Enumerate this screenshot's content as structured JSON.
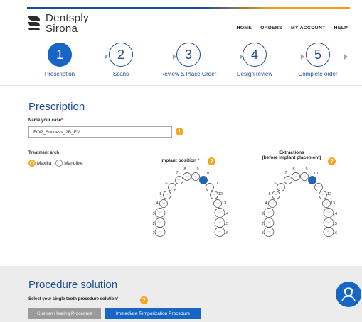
{
  "brand": {
    "line1": "Dentsply",
    "line2": "Sirona"
  },
  "nav": {
    "home": "HOME",
    "orders": "ORDERS",
    "account": "MY ACCOUNT",
    "help": "HELP"
  },
  "steps": [
    {
      "num": "1",
      "label": "Prescription",
      "active": true
    },
    {
      "num": "2",
      "label": "Scans",
      "active": false
    },
    {
      "num": "3",
      "label": "Review & Place Order",
      "active": false
    },
    {
      "num": "4",
      "label": "Design review",
      "active": false
    },
    {
      "num": "5",
      "label": "Complete order",
      "active": false
    }
  ],
  "prescription": {
    "title": "Prescription",
    "case_label": "Name your case",
    "case_required": "*",
    "case_value": "FOP_Success_2B_EV",
    "arch_label": "Treatment arch",
    "arch_options": [
      "Maxilla",
      "Mandible"
    ],
    "arch_selected": "Maxilla",
    "implant_title": "Implant position",
    "implant_required": "*",
    "extraction_title_1": "Extractions",
    "extraction_title_2": "(before implant placement)",
    "tooth_numbers": [
      "1",
      "2",
      "3",
      "4",
      "5",
      "6",
      "7",
      "8",
      "9",
      "10",
      "11",
      "12",
      "13",
      "14",
      "15",
      "16"
    ],
    "implant_selected_tooth": "10",
    "extraction_selected_tooth": "10",
    "help_glyph": "?",
    "warn_glyph": "!"
  },
  "procedure": {
    "title": "Procedure solution",
    "label": "Select your single tooth procedure solution",
    "required": "*",
    "buttons": [
      "Custom Healing Procedure",
      "Immediate Temporization Procedure"
    ]
  },
  "colors": {
    "primary": "#1e4c8f",
    "active": "#1766c6",
    "accent": "#f5a623",
    "gray_button": "#9a9a9a"
  },
  "icons": {
    "support": "support-agent-icon"
  }
}
